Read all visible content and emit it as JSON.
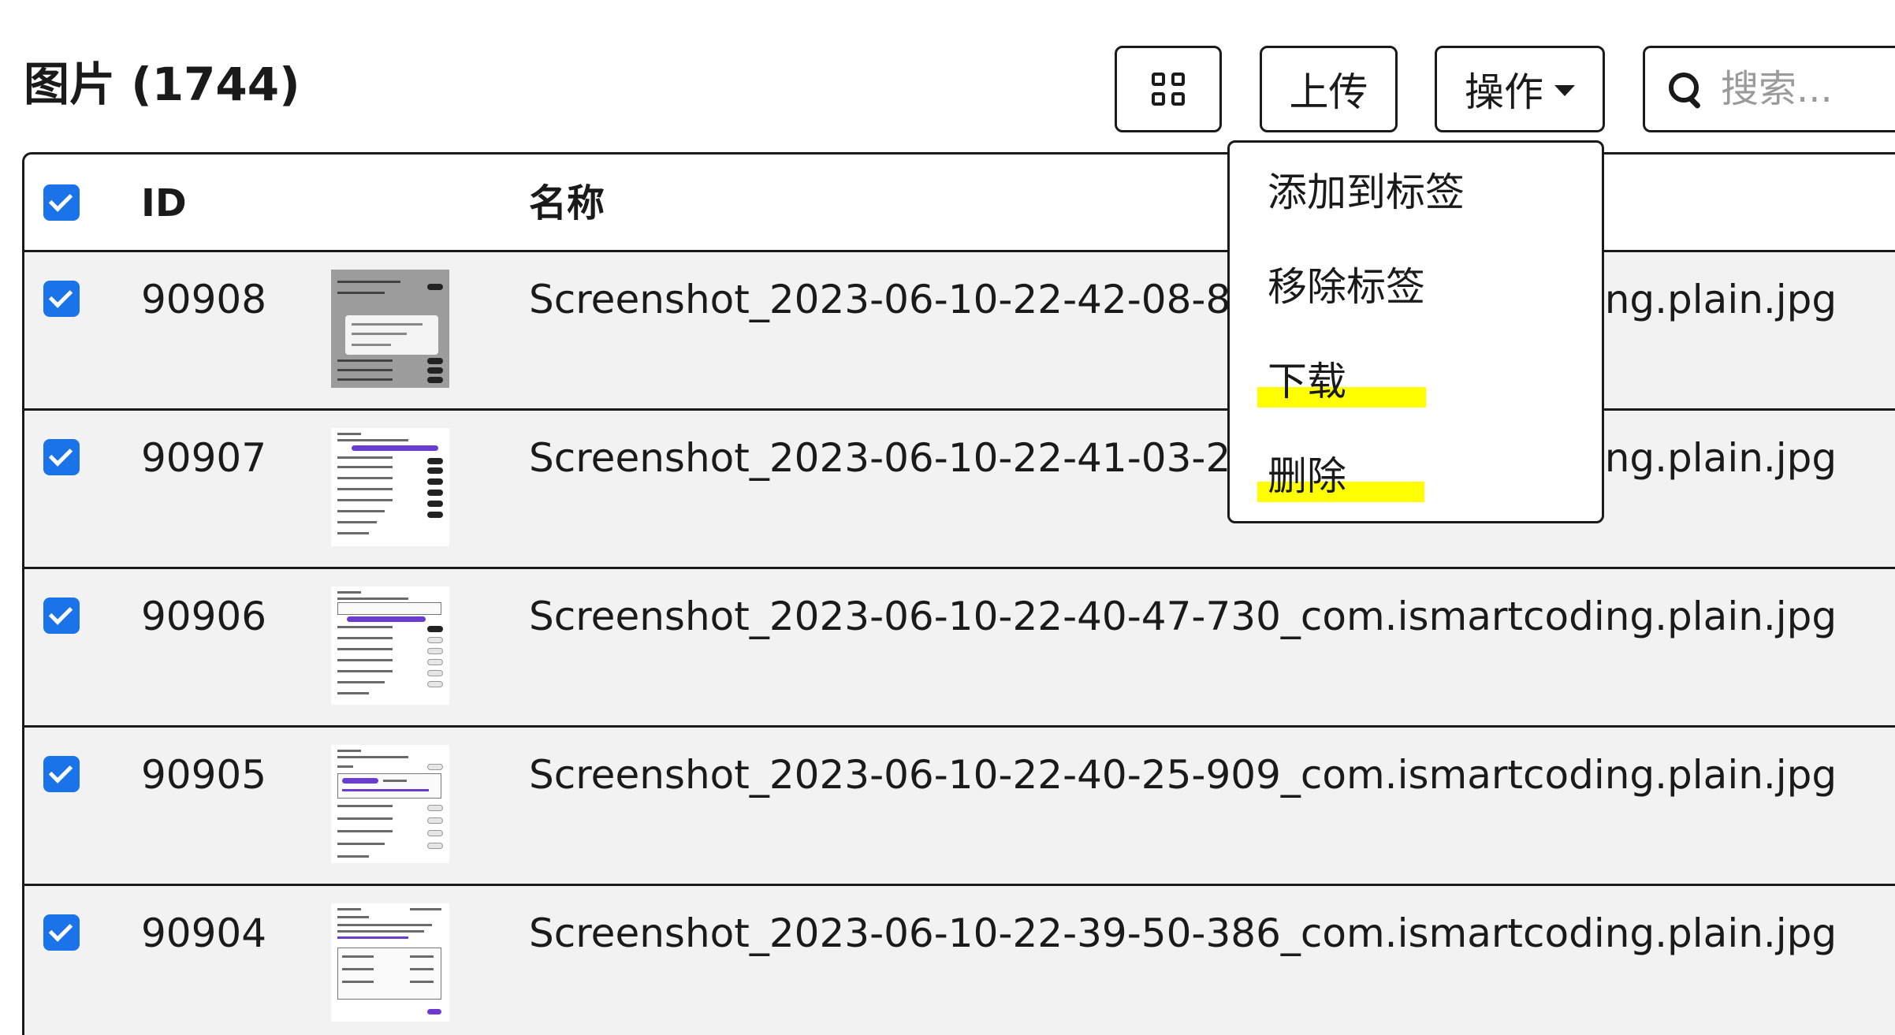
{
  "header": {
    "title": "图片 (1744)"
  },
  "toolbar": {
    "view_toggle_icon": "grid-icon",
    "upload_label": "上传",
    "actions_label": "操作"
  },
  "search": {
    "placeholder": "搜索...",
    "value": ""
  },
  "table": {
    "columns": [
      "",
      "ID",
      "",
      "名称"
    ],
    "select_all_checked": true,
    "rows": [
      {
        "checked": true,
        "id": "90908",
        "name": "Screenshot_2023-06-10-22-42-08-865_com.ismartcoding.plain.jpg"
      },
      {
        "checked": true,
        "id": "90907",
        "name": "Screenshot_2023-06-10-22-41-03-214_com.ismartcoding.plain.jpg"
      },
      {
        "checked": true,
        "id": "90906",
        "name": "Screenshot_2023-06-10-22-40-47-730_com.ismartcoding.plain.jpg"
      },
      {
        "checked": true,
        "id": "90905",
        "name": "Screenshot_2023-06-10-22-40-25-909_com.ismartcoding.plain.jpg"
      },
      {
        "checked": true,
        "id": "90904",
        "name": "Screenshot_2023-06-10-22-39-50-386_com.ismartcoding.plain.jpg"
      }
    ]
  },
  "actions_menu": {
    "open": true,
    "items": [
      {
        "label": "添加到标签",
        "highlighted": false
      },
      {
        "label": "移除标签",
        "highlighted": false
      },
      {
        "label": "下载",
        "highlighted": true
      },
      {
        "label": "删除",
        "highlighted": true
      }
    ],
    "highlight_color": "#ffff00"
  },
  "colors": {
    "checkbox": "#1a73e8",
    "row_background": "#f2f2f2",
    "border": "#1a1a1a"
  }
}
